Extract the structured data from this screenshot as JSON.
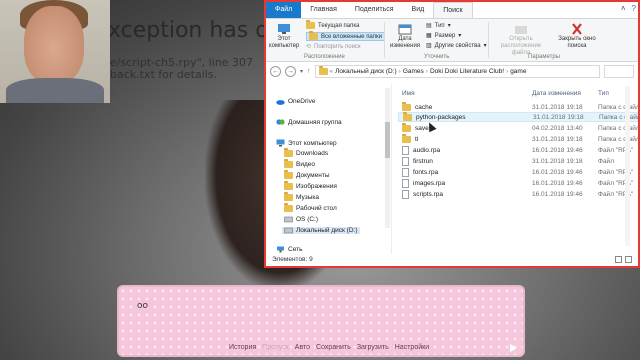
{
  "game": {
    "error_title": "xception has oc",
    "error_line1": "e/script-ch5.rpy\", line 307",
    "error_line2": "back.txt for details.",
    "dialogue_text": "oo",
    "quick_menu": [
      "История",
      "Пропуск",
      "Авто",
      "Сохранить",
      "Загрузить",
      "Настройки"
    ]
  },
  "explorer": {
    "tabs": [
      "Файл",
      "Главная",
      "Поделиться",
      "Вид",
      "Поиск"
    ],
    "ribbon": {
      "this_computer": "Этот компьютер",
      "current_folder": "Текущая папка",
      "all_subfolders": "Все вложенные папки",
      "search_again": "Повторить поиск",
      "group_location": "Расположение",
      "change_date": "Дата изменения",
      "type": "Тип",
      "size": "Размер",
      "other_props": "Другие свойства",
      "group_refine": "Уточнить",
      "open_location": "Открыть расположение файла",
      "close_search": "Закрыть окно поиска",
      "group_params": "Параметры"
    },
    "address": [
      "Локальный диск (D:)",
      "Games",
      "Doki Doki Literature Club!",
      "game"
    ],
    "nav_items": [
      {
        "label": "OneDrive",
        "icon": "cloud-icon"
      },
      {
        "label": "Домашняя группа",
        "icon": "homegroup-icon"
      },
      {
        "label": "Этот компьютер",
        "icon": "computer-icon"
      },
      {
        "label": "Downloads",
        "icon": "folder-icon"
      },
      {
        "label": "Видео",
        "icon": "folder-icon"
      },
      {
        "label": "Документы",
        "icon": "folder-icon"
      },
      {
        "label": "Изображения",
        "icon": "folder-icon"
      },
      {
        "label": "Музыка",
        "icon": "folder-icon"
      },
      {
        "label": "Рабочий стол",
        "icon": "folder-icon"
      },
      {
        "label": "OS (C:)",
        "icon": "drive-icon"
      },
      {
        "label": "Локальный диск (D:)",
        "icon": "drive-icon"
      },
      {
        "label": "Сеть",
        "icon": "network-icon"
      }
    ],
    "columns": {
      "name": "Имя",
      "date": "Дата изменения",
      "type": "Тип"
    },
    "files": [
      {
        "name": "cache",
        "date": "31.01.2018 19:18",
        "type": "Папка с файлами",
        "kind": "folder"
      },
      {
        "name": "python-packages",
        "date": "31.01.2018 19:18",
        "type": "Папка с файлами",
        "kind": "folder"
      },
      {
        "name": "saves",
        "date": "04.02.2018 13:40",
        "type": "Папка с файлами",
        "kind": "folder"
      },
      {
        "name": "tl",
        "date": "31.01.2018 19:18",
        "type": "Папка с файлами",
        "kind": "folder"
      },
      {
        "name": "audio.rpa",
        "date": "16.01.2018 19:46",
        "type": "Файл \"RPA\"",
        "kind": "file"
      },
      {
        "name": "firstrun",
        "date": "31.01.2018 19:18",
        "type": "Файл",
        "kind": "file"
      },
      {
        "name": "fonts.rpa",
        "date": "16.01.2018 19:46",
        "type": "Файл \"RPA\"",
        "kind": "file"
      },
      {
        "name": "images.rpa",
        "date": "16.01.2018 19:46",
        "type": "Файл \"RPA\"",
        "kind": "file"
      },
      {
        "name": "scripts.rpa",
        "date": "16.01.2018 19:46",
        "type": "Файл \"RPA\"",
        "kind": "file"
      }
    ],
    "status": "Элементов: 9"
  }
}
